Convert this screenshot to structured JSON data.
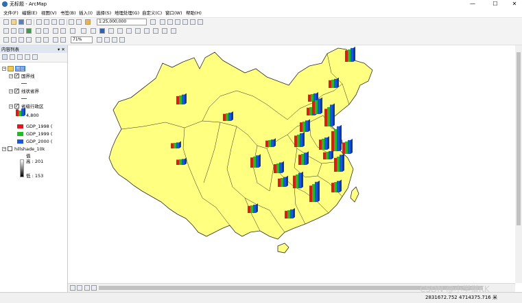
{
  "window": {
    "title": "无标题 - ArcMap",
    "controls": {
      "minimize": "—",
      "maximize": "☐",
      "close": "✕"
    }
  },
  "menu": [
    "文件(F)",
    "编辑(E)",
    "视图(V)",
    "书签(B)",
    "插入(I)",
    "选择(S)",
    "地理处理(G)",
    "自定义(C)",
    "窗口(W)",
    "帮助(H)"
  ],
  "toolbar": {
    "scale": "1:25,000,000",
    "zoom_percent": "71%"
  },
  "toc": {
    "title": "内容列表",
    "pin": "▾ ✕",
    "frame_label": "图层",
    "layers": [
      {
        "name": "国界线",
        "checked": true
      },
      {
        "name": "线状省界",
        "checked": true
      },
      {
        "name": "省级行政区",
        "checked": true,
        "chart_label": "4,800"
      },
      {
        "name": "hillshade_10k",
        "checked": false
      }
    ],
    "legend": [
      {
        "label": "GDP_1998  (",
        "color": "#e8141c"
      },
      {
        "label": "GDP_1999  (",
        "color": "#19c219"
      },
      {
        "label": "GDP_2000  (",
        "color": "#1656e8"
      }
    ],
    "hillshade": {
      "value_label": "值",
      "high": "高 : 201",
      "low": "低 : 153"
    }
  },
  "map": {
    "land_color": "#ffff80",
    "border_color": "#2b2b2b",
    "province_chart_count": 26
  },
  "status": {
    "coordinates": "2831672.752  4714375.716 米"
  },
  "watermark": "CSDN @小学僧KK"
}
